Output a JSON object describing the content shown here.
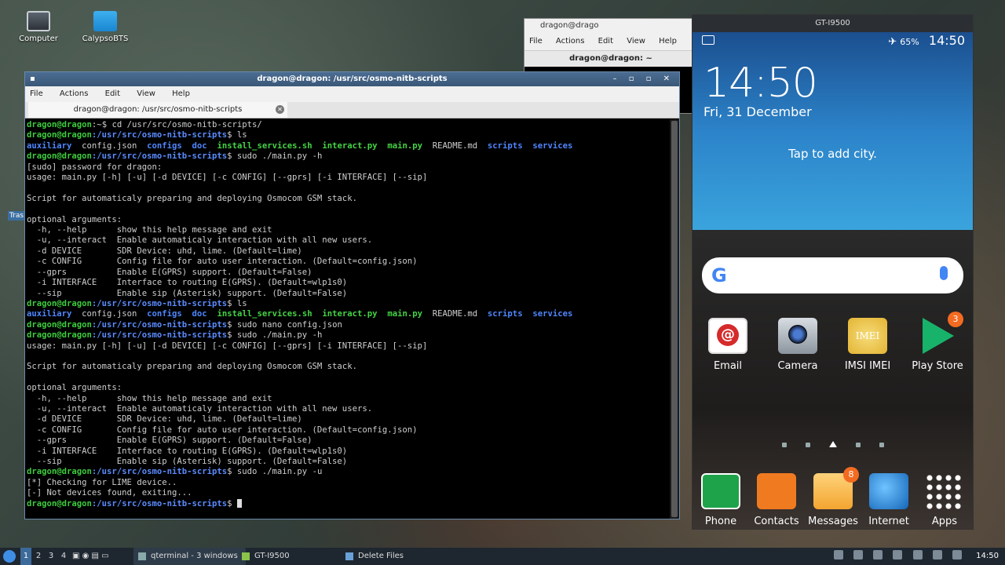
{
  "desktop": {
    "icons": [
      {
        "label": "Computer"
      },
      {
        "label": "CalypsoBTS"
      }
    ],
    "trash_tab": "Tras"
  },
  "bg_terminal": {
    "title": "dragon@drago",
    "menu": [
      "File",
      "Actions",
      "Edit",
      "View",
      "Help"
    ],
    "tab": "dragon@dragon: ~"
  },
  "terminal": {
    "title": "dragon@dragon: /usr/src/osmo-nitb-scripts",
    "controls": "– ▫ ▫ ✕",
    "menu": [
      "File",
      "Actions",
      "Edit",
      "View",
      "Help"
    ],
    "tab_label": "dragon@dragon: /usr/src/osmo-nitb-scripts",
    "prompt_user": "dragon@dragon",
    "prompt_home": ":~",
    "prompt_path": ":/usr/src/osmo-nitb-scripts",
    "ls_dirs_a": [
      "auxiliary"
    ],
    "ls_line": {
      "f1": "auxiliary",
      "f2": "config.json",
      "f3": "configs",
      "f4": "doc",
      "f5": "install_services.sh",
      "f6": "interact.py",
      "f7": "main.py",
      "f8": "README.md",
      "f9": "scripts",
      "f10": "services"
    },
    "cmd_cd": "$ cd /usr/src/osmo-nitb-scripts/",
    "cmd_ls": "$ ls",
    "cmd_help_h": "$ sudo ./main.py -h",
    "cmd_nano": "$ sudo nano config.json",
    "cmd_help_h2": "$ sudo ./main.py -h",
    "cmd_run_u": "$ sudo ./main.py -u",
    "prompt_end": "$ ",
    "sudo_pw": "[sudo] password for dragon:",
    "usage": "usage: main.py [-h] [-u] [-d DEVICE] [-c CONFIG] [--gprs] [-i INTERFACE] [--sip]",
    "desc": "Script for automaticaly preparing and deploying Osmocom GSM stack.",
    "opt_header": "optional arguments:",
    "opts": [
      "  -h, --help      show this help message and exit",
      "  -u, --interact  Enable automaticaly interaction with all new users.",
      "  -d DEVICE       SDR Device: uhd, lime. (Default=lime)",
      "  -c CONFIG       Config file for auto user interaction. (Default=config.json)",
      "  --gprs          Enable E(GPRS) support. (Default=False)",
      "  -i INTERFACE    Interface to routing E(GPRS). (Default=wlp1s0)",
      "  --sip           Enable sip (Asterisk) support. (Default=False)"
    ],
    "check_lime": "[*] Checking for LIME device..",
    "not_found": "[-] Not devices found, exiting..."
  },
  "phone": {
    "window_title": "GT-I9500",
    "battery": "65%",
    "status_time": "14:50",
    "clock": "14:50",
    "date": "Fri, 31 December",
    "city_prompt": "Tap to add city.",
    "search_logo": "G",
    "apps_row1": [
      {
        "label": "Email",
        "icon": "email-icon"
      },
      {
        "label": "Camera",
        "icon": "camera-icon"
      },
      {
        "label": "IMSI IMEI",
        "icon": "imei-icon",
        "icon_text": "IMEI"
      },
      {
        "label": "Play Store",
        "icon": "play-store-icon",
        "badge": "3"
      }
    ],
    "apps_dock": [
      {
        "label": "Phone",
        "icon": "phone-icon"
      },
      {
        "label": "Contacts",
        "icon": "contacts-icon"
      },
      {
        "label": "Messages",
        "icon": "messages-icon",
        "badge": "8"
      },
      {
        "label": "Internet",
        "icon": "internet-icon"
      },
      {
        "label": "Apps",
        "icon": "apps-grid-icon"
      }
    ]
  },
  "taskbar": {
    "desktops": [
      "1",
      "2",
      "3",
      "4"
    ],
    "tasks": [
      {
        "label": "qterminal - 3 windows"
      },
      {
        "label": "GT-I9500"
      },
      {
        "label": "Delete Files"
      }
    ],
    "clock": "14:50"
  }
}
